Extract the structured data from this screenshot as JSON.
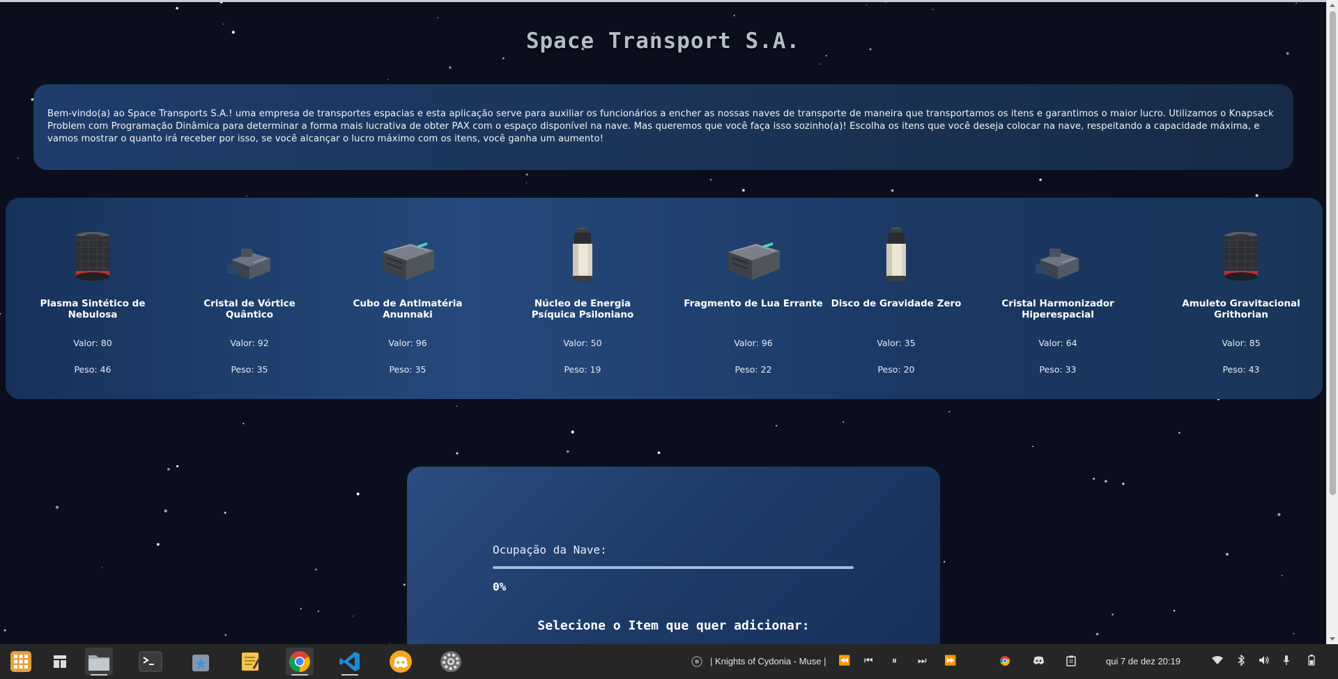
{
  "page": {
    "title": "Space Transport S.A.",
    "intro": "Bem-vindo(a) ao Space Transports S.A.! uma empresa de transportes espacias e esta aplicação serve para auxiliar os funcionários a encher as nossas naves de transporte de maneira que transportamos os itens e garantimos o maior lucro. Utilizamos o Knapsack Problem com Programação Dinâmica para determinar a forma mais lucrativa de obter PAX com o espaço disponível na nave. Mas queremos que você faça isso sozinho(a)! Escolha os itens que você deseja colocar na nave, respeitando a capacidade máxima, e vamos mostrar o quanto irá receber por isso, se você alcançar o lucro máximo com os itens, você ganha um aumento!"
  },
  "items": [
    {
      "name": "Plasma Sintético de Nebulosa",
      "value": "Valor: 80",
      "weight": "Peso: 46",
      "icon": "canister-icon"
    },
    {
      "name": "Cristal de Vórtice Quântico",
      "value": "Valor: 92",
      "weight": "Peso: 35",
      "icon": "crate-small-icon"
    },
    {
      "name": "Cubo de Antimatéria Anunnaki",
      "value": "Valor: 96",
      "weight": "Peso: 35",
      "icon": "cargo-box-icon"
    },
    {
      "name": "Núcleo de Energia Psíquica Psiloniano",
      "value": "Valor: 50",
      "weight": "Peso: 19",
      "icon": "bottle-icon"
    },
    {
      "name": "Fragmento de Lua Errante",
      "value": "Valor: 96",
      "weight": "Peso: 22",
      "icon": "cargo-box-icon"
    },
    {
      "name": "Disco de Gravidade Zero",
      "value": "Valor: 35",
      "weight": "Peso: 20",
      "icon": "bottle-icon"
    },
    {
      "name": "Cristal Harmonizador Hiperespacial",
      "value": "Valor: 64",
      "weight": "Peso: 33",
      "icon": "crate-small-icon"
    },
    {
      "name": "Amuleto Gravitacional Grithorian",
      "value": "Valor: 85",
      "weight": "Peso: 43",
      "icon": "canister-icon"
    }
  ],
  "ship": {
    "occupation_label": "Ocupação da Nave:",
    "occupation_percent": "0%",
    "occupation_fraction": 0,
    "select_label": "Selecione o Item que quer adicionar:"
  },
  "taskbar": {
    "apps": [
      "app-grid-icon",
      "workspace-icon",
      "files-icon",
      "terminal-icon",
      "app-store-icon",
      "text-editor-icon",
      "chrome-icon",
      "vscode-icon",
      "discord-icon",
      "settings-icon"
    ],
    "media_title": "| Knights of Cydonia - Muse |",
    "clock": "qui 7 de dez  20:19"
  }
}
